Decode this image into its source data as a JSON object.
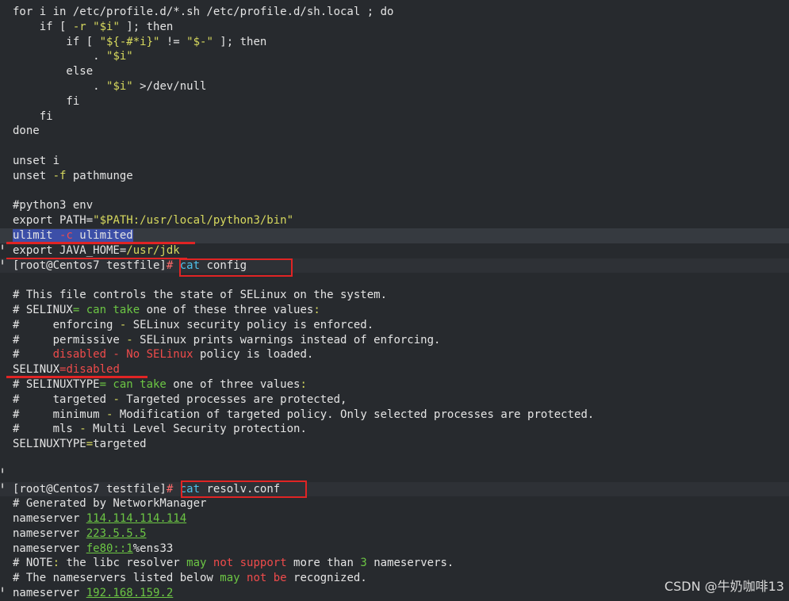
{
  "terminal": {
    "lines": [
      {
        "segs": [
          [
            "",
            "for i in /etc/profile.d/*.sh /etc/profile.d/sh.local ; do"
          ]
        ]
      },
      {
        "segs": [
          [
            "",
            "    if [ "
          ],
          [
            "y",
            "-r"
          ],
          [
            "",
            " "
          ],
          [
            "y",
            "\"$i\""
          ],
          [
            "",
            " ]; then"
          ]
        ]
      },
      {
        "segs": [
          [
            "",
            "        if [ "
          ],
          [
            "y",
            "\"${-#*i}\""
          ],
          [
            "",
            " != "
          ],
          [
            "y",
            "\"$-\""
          ],
          [
            "",
            " ]; then"
          ]
        ]
      },
      {
        "segs": [
          [
            "",
            "            . "
          ],
          [
            "y",
            "\"$i\""
          ]
        ]
      },
      {
        "segs": [
          [
            "",
            "        else"
          ]
        ]
      },
      {
        "segs": [
          [
            "",
            "            . "
          ],
          [
            "y",
            "\"$i\""
          ],
          [
            "",
            " >/dev/null"
          ]
        ]
      },
      {
        "segs": [
          [
            "",
            "        fi"
          ]
        ]
      },
      {
        "segs": [
          [
            "",
            "    fi"
          ]
        ]
      },
      {
        "segs": [
          [
            "",
            "done"
          ]
        ]
      },
      {
        "segs": [
          [
            "",
            ""
          ]
        ]
      },
      {
        "segs": [
          [
            "",
            "unset i"
          ]
        ]
      },
      {
        "segs": [
          [
            "",
            "unset "
          ],
          [
            "y",
            "-f"
          ],
          [
            "",
            " pathmunge"
          ]
        ]
      },
      {
        "segs": [
          [
            "",
            ""
          ]
        ]
      },
      {
        "segs": [
          [
            "",
            "#python3 env"
          ]
        ]
      },
      {
        "segs": [
          [
            "",
            "export PATH="
          ],
          [
            "y",
            "\"$PATH:/usr/local/python3/bin\""
          ]
        ]
      },
      {
        "hl": true,
        "segs": [
          [
            "sel",
            "ulimit "
          ],
          [
            "sel r",
            "-c"
          ],
          [
            "sel",
            " ulimited"
          ]
        ]
      },
      {
        "gutter": "╹",
        "segs": [
          [
            "",
            "export JAVA_HOME="
          ],
          [
            "y",
            "/usr/jdk"
          ]
        ]
      },
      {
        "prompt": true,
        "gutter": "╹",
        "segs": [
          [
            "",
            "[root@Centos7 testfile]"
          ],
          [
            "m",
            "#"
          ],
          [
            "",
            " "
          ],
          [
            "c",
            "cat"
          ],
          [
            "",
            " config"
          ]
        ]
      },
      {
        "segs": [
          [
            "",
            ""
          ]
        ]
      },
      {
        "segs": [
          [
            "",
            "# This file controls the state of SELinux on the system."
          ]
        ]
      },
      {
        "segs": [
          [
            "",
            "# SELINUX"
          ],
          [
            "g",
            "= can take"
          ],
          [
            "",
            " one of these three values"
          ],
          [
            "y",
            ":"
          ]
        ]
      },
      {
        "segs": [
          [
            "",
            "#     enforcing "
          ],
          [
            "y",
            "-"
          ],
          [
            "",
            " SELinux security policy is enforced."
          ]
        ]
      },
      {
        "segs": [
          [
            "",
            "#     permissive "
          ],
          [
            "y",
            "-"
          ],
          [
            "",
            " SELinux prints warnings instead of enforcing."
          ]
        ]
      },
      {
        "segs": [
          [
            "",
            "#     "
          ],
          [
            "r",
            "disabled - No SELinux"
          ],
          [
            "",
            " policy is loaded."
          ]
        ]
      },
      {
        "segs": [
          [
            "",
            "SELINUX"
          ],
          [
            "r",
            "=disabled"
          ]
        ]
      },
      {
        "segs": [
          [
            "",
            "# SELINUXTYPE"
          ],
          [
            "g",
            "= can take"
          ],
          [
            "",
            " one of three values"
          ],
          [
            "y",
            ":"
          ]
        ]
      },
      {
        "segs": [
          [
            "",
            "#     targeted "
          ],
          [
            "y",
            "-"
          ],
          [
            "",
            " Targeted processes are protected,"
          ]
        ]
      },
      {
        "segs": [
          [
            "",
            "#     minimum "
          ],
          [
            "y",
            "-"
          ],
          [
            "",
            " Modification of targeted policy. Only selected processes are protected."
          ]
        ]
      },
      {
        "segs": [
          [
            "",
            "#     mls "
          ],
          [
            "y",
            "-"
          ],
          [
            "",
            " Multi Level Security protection."
          ]
        ]
      },
      {
        "segs": [
          [
            "",
            "SELINUXTYPE"
          ],
          [
            "y",
            "="
          ],
          [
            "",
            "targeted"
          ]
        ]
      },
      {
        "segs": [
          [
            "",
            ""
          ]
        ]
      },
      {
        "gutter": "╹",
        "segs": [
          [
            "",
            ""
          ]
        ]
      },
      {
        "prompt": true,
        "gutter": "╹",
        "segs": [
          [
            "",
            "[root@Centos7 testfile]"
          ],
          [
            "m",
            "#"
          ],
          [
            "",
            " "
          ],
          [
            "c",
            "cat"
          ],
          [
            "",
            " resolv.conf"
          ]
        ]
      },
      {
        "segs": [
          [
            "",
            "# Generated by NetworkManager"
          ]
        ]
      },
      {
        "segs": [
          [
            "",
            "nameserver "
          ],
          [
            "g u",
            "114.114.114.114"
          ]
        ]
      },
      {
        "segs": [
          [
            "",
            "nameserver "
          ],
          [
            "g u",
            "223.5.5.5"
          ]
        ]
      },
      {
        "segs": [
          [
            "",
            "nameserver "
          ],
          [
            "g u",
            "fe80::1"
          ],
          [
            "",
            "%ens33"
          ]
        ]
      },
      {
        "segs": [
          [
            "",
            "# NOTE"
          ],
          [
            "y",
            ":"
          ],
          [
            "",
            " the libc resolver "
          ],
          [
            "g",
            "may"
          ],
          [
            "",
            " "
          ],
          [
            "r",
            "not support"
          ],
          [
            "",
            " more than "
          ],
          [
            "g",
            "3"
          ],
          [
            "",
            " nameservers."
          ]
        ]
      },
      {
        "segs": [
          [
            "",
            "# The nameservers listed below "
          ],
          [
            "g",
            "may"
          ],
          [
            "",
            " "
          ],
          [
            "r",
            "not be"
          ],
          [
            "",
            " recognized."
          ]
        ]
      },
      {
        "gutter": "╹",
        "segs": [
          [
            "",
            "nameserver "
          ],
          [
            "g u",
            "192.168.159.2"
          ]
        ]
      }
    ]
  },
  "watermark": "CSDN @牛奶咖啡13"
}
